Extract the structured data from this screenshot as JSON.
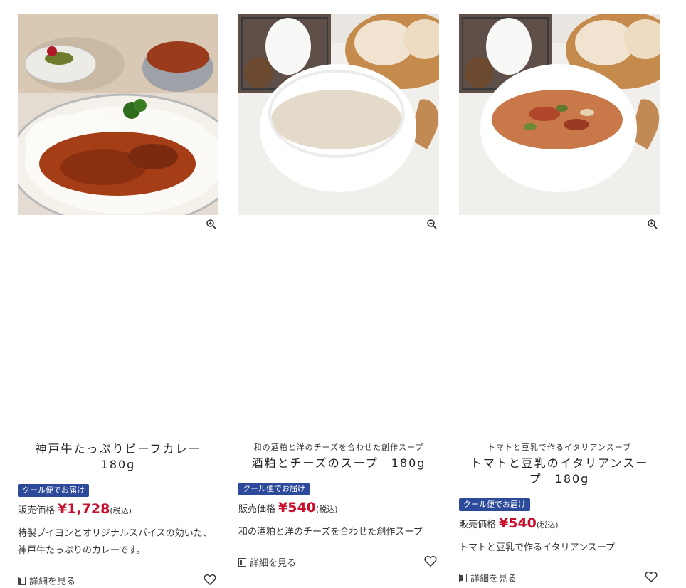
{
  "products": [
    {
      "subtitle": "",
      "name": "神戸牛たっぷりビーフカレー　180g",
      "badge": "クール便でお届け",
      "price_label": "販売価格",
      "price": "¥1,728",
      "tax": "(税込)",
      "description": "特製ブイヨンとオリジナルスパイスの効いた、神戸牛たっぷりのカレーです。",
      "detail_label": "詳細を見る",
      "icons": {
        "zoom": "zoom-in-icon",
        "detail": "document-icon",
        "favorite": "heart-icon"
      }
    },
    {
      "subtitle": "和の酒粕と洋のチーズを合わせた創作スープ",
      "name": "酒粕とチーズのスープ　180g",
      "badge": "クール便でお届け",
      "price_label": "販売価格",
      "price": "¥540",
      "tax": "(税込)",
      "description": "和の酒粕と洋のチーズを合わせた創作スープ",
      "detail_label": "詳細を見る",
      "icons": {
        "zoom": "zoom-in-icon",
        "detail": "document-icon",
        "favorite": "heart-icon"
      }
    },
    {
      "subtitle": "トマトと豆乳で作るイタリアンスープ",
      "name": "トマトと豆乳のイタリアンスープ　180g",
      "badge": "クール便でお届け",
      "price_label": "販売価格",
      "price": "¥540",
      "tax": "(税込)",
      "description": "トマトと豆乳で作るイタリアンスープ",
      "detail_label": "詳細を見る",
      "icons": {
        "zoom": "zoom-in-icon",
        "detail": "document-icon",
        "favorite": "heart-icon"
      }
    }
  ],
  "colors": {
    "badge_bg": "#2d4a9a",
    "price": "#c8102e",
    "text": "#333333"
  }
}
